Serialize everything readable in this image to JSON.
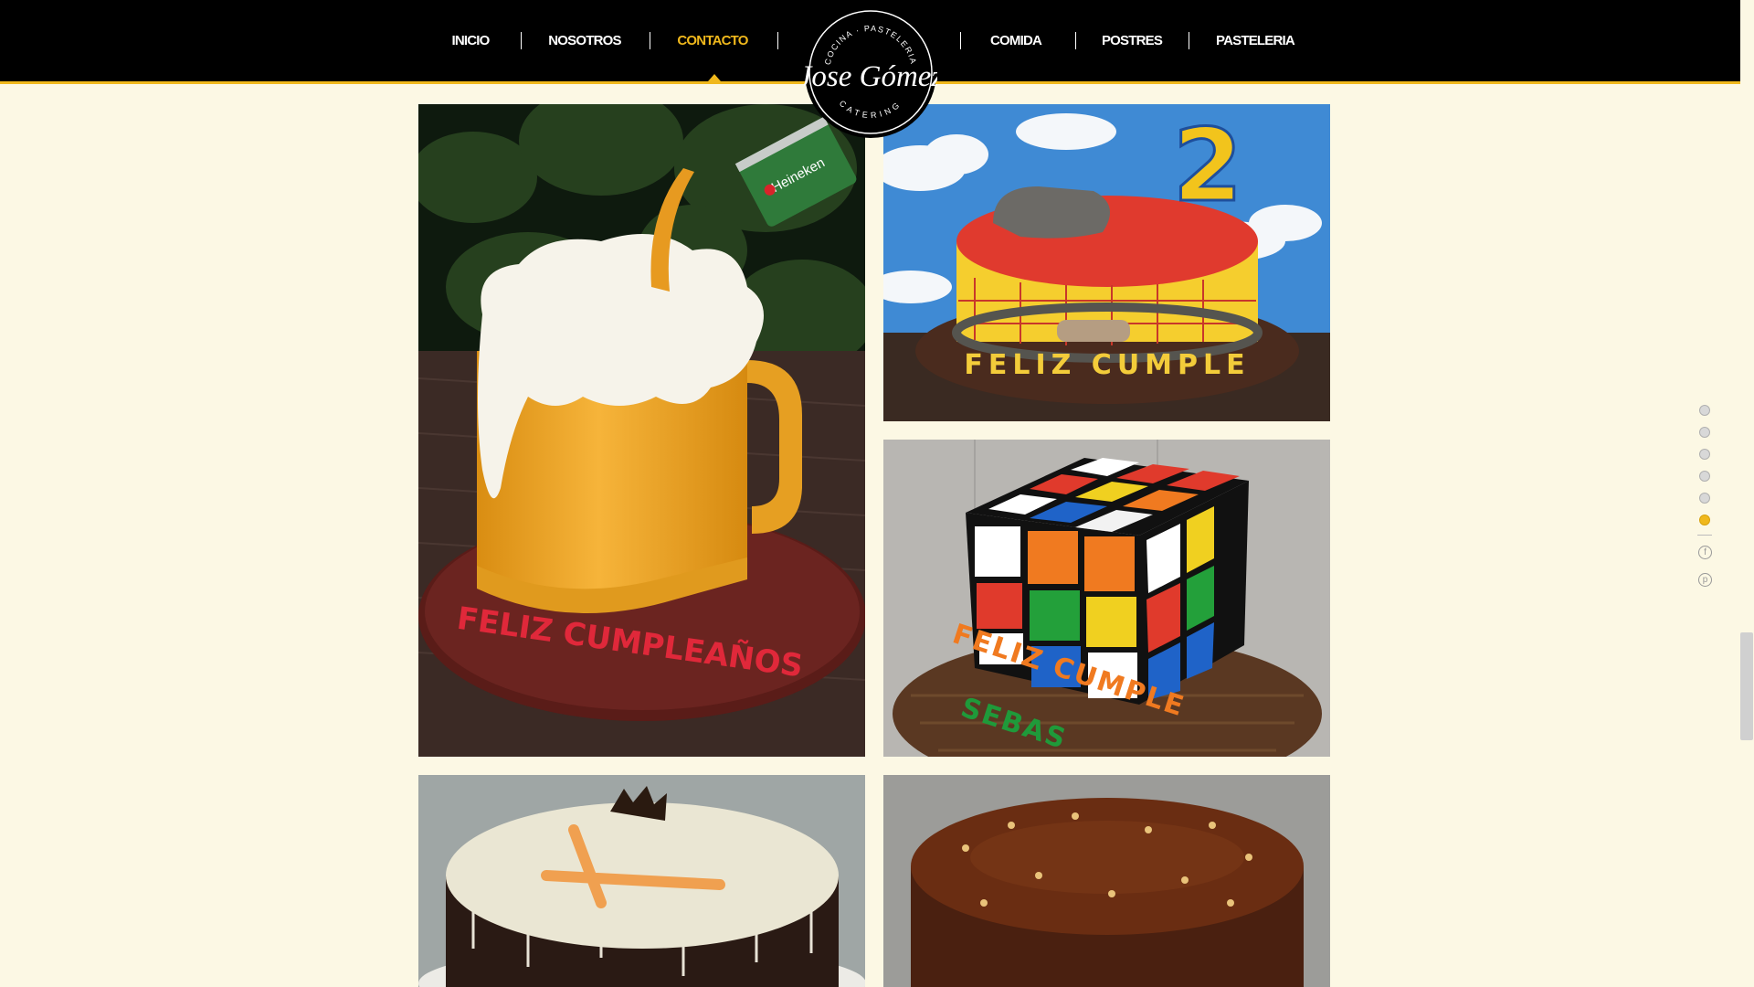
{
  "nav": {
    "items": [
      {
        "label": "INICIO"
      },
      {
        "label": "NOSOTROS"
      },
      {
        "label": "CONTACTO",
        "active": true
      },
      {
        "label": "COMIDA"
      },
      {
        "label": "POSTRES"
      },
      {
        "label": "PASTELERIA"
      }
    ]
  },
  "logo": {
    "top_text": "COCINA · PASTELERIA",
    "name": "Jose Gómez",
    "bottom_text": "CATERING"
  },
  "gallery": {
    "photos": [
      {
        "subject": "beer mug cake",
        "cake_text": "FELIZ CUMPLEAÑOS",
        "can_text": "Heineken"
      },
      {
        "subject": "cowboy cake",
        "number_topper": "2",
        "cake_text": "FELIZ CUMPLE"
      },
      {
        "subject": "rubik cube cake",
        "cake_text": "FELIZ CUMPLE",
        "cake_text_2": "SEBAS"
      },
      {
        "subject": "white chocolate cake"
      },
      {
        "subject": "chocolate glazed cake"
      }
    ]
  },
  "side_nav": {
    "dots": 6,
    "active_index": 5
  },
  "social": [
    {
      "icon": "facebook-icon",
      "glyph": "f"
    },
    {
      "icon": "pinterest-icon",
      "glyph": "p"
    }
  ],
  "colors": {
    "accent": "#f0b81c",
    "nav_bg": "#000000",
    "page_bg": "#fcf8e4"
  }
}
